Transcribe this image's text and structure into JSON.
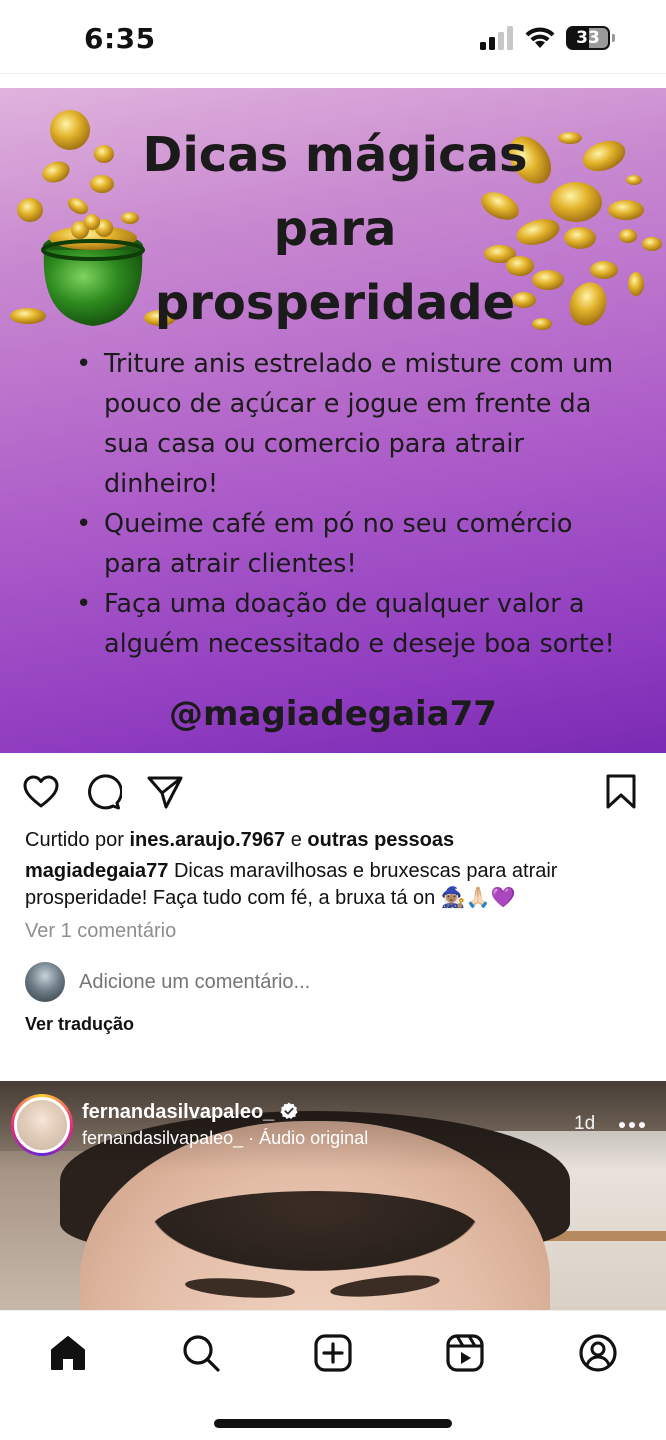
{
  "status_bar": {
    "time": "6:35",
    "battery": "33"
  },
  "post": {
    "image": {
      "title": "Dicas mágicas para prosperidade",
      "tips": [
        "Triture anis estrelado e misture com um pouco de açúcar e jogue em frente da sua casa ou comercio para atrair dinheiro!",
        "Queime café em pó no seu comércio para atrair clientes!",
        "Faça uma doação de qualquer valor a alguém necessitado e deseje boa sorte!"
      ],
      "handle": "@magiadegaia77"
    },
    "likes_prefix": "Curtido por",
    "likes_user": "ines.araujo.7967",
    "likes_connector": "e",
    "likes_others": "outras pessoas",
    "caption_user": "magiadegaia77",
    "caption_text": "Dicas maravilhosas e bruxescas para atrair prosperidade! Faça tudo com fé, a bruxa tá on 🧙🏽‍♀️🙏🏻💜",
    "view_comments": "Ver 1 comentário",
    "comment_placeholder": "Adicione um comentário...",
    "translate": "Ver tradução"
  },
  "next_post": {
    "username": "fernandasilvapaleo_",
    "subtitle": "fernandasilvapaleo_ · Áudio original",
    "time": "1d"
  },
  "icons": {
    "actions": [
      "heart-icon",
      "comment-icon",
      "share-icon",
      "bookmark-icon"
    ],
    "tabs": [
      "home-icon",
      "search-icon",
      "create-icon",
      "reels-icon",
      "profile-icon"
    ]
  },
  "colors": {
    "image_gradient_top": "#e0b3dd",
    "image_gradient_bottom": "#7a2ab3",
    "muted_text": "#8e8e8e",
    "coin_gold": "#d9a520",
    "pot_green": "#2e8b1f"
  }
}
